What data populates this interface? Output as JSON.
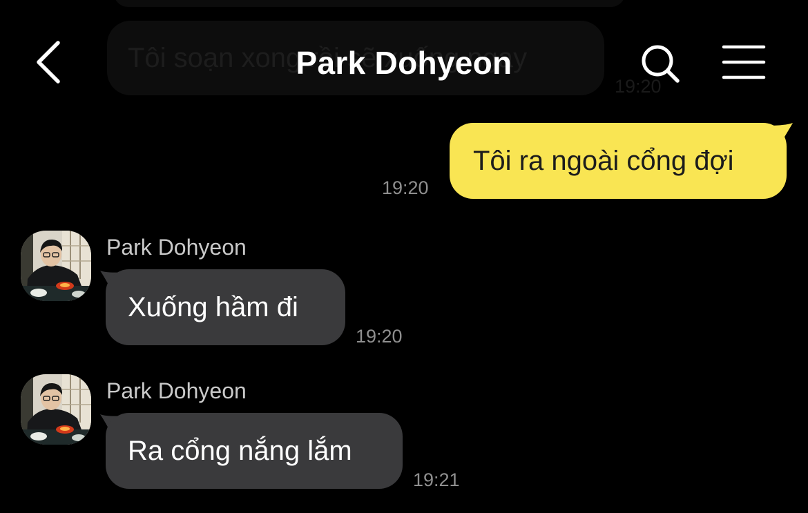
{
  "header": {
    "title": "Park Dohyeon",
    "back_icon": "chevron-left-icon",
    "search_icon": "search-icon",
    "menu_icon": "hamburger-menu-icon"
  },
  "colors": {
    "background": "#000000",
    "sent_bubble": "#f9e553",
    "received_bubble": "#3a3a3c",
    "timestamp": "#8f8f8f"
  },
  "previous_message": {
    "text": "Tôi soạn xong rồi sẽ xuống ngay",
    "time": "19:20"
  },
  "messages": [
    {
      "direction": "sent",
      "text": "Tôi ra ngoài cổng đợi",
      "time": "19:20"
    },
    {
      "direction": "received",
      "sender": "Park Dohyeon",
      "text": "Xuống hầm đi",
      "time": "19:20"
    },
    {
      "direction": "received",
      "sender": "Park Dohyeon",
      "text": "Ra cổng nắng lắm",
      "time": "19:21"
    }
  ]
}
